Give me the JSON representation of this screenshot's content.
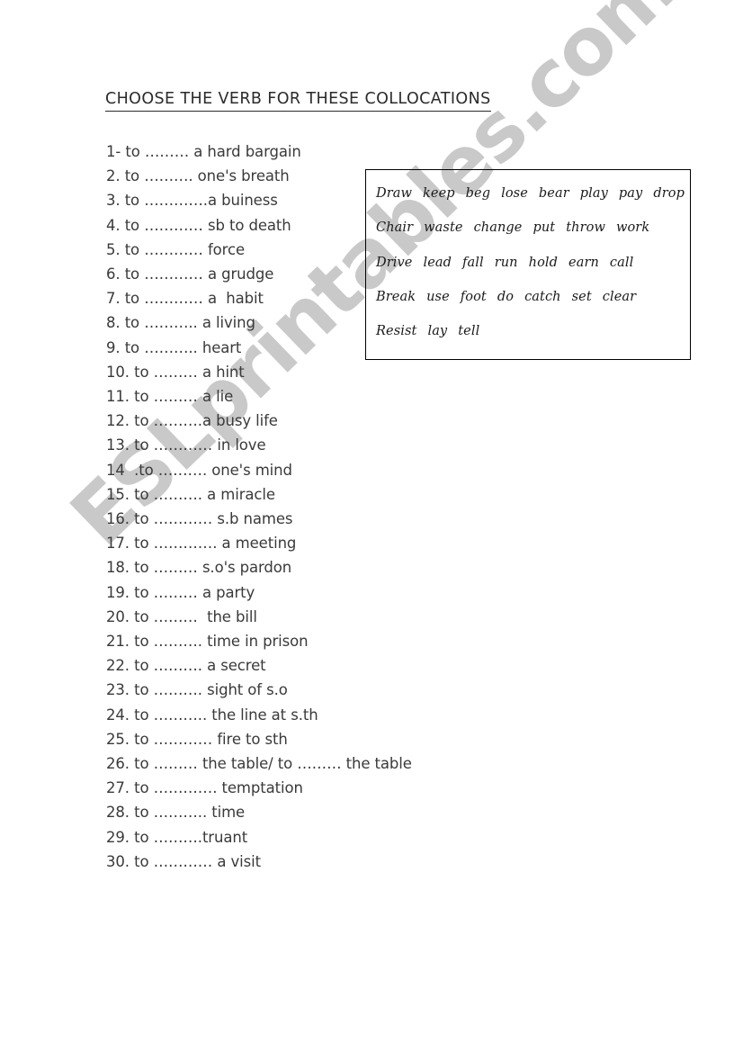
{
  "page": {
    "title": "CHOOSE THE VERB FOR THESE COLLOCATIONS",
    "watermark": "ESLprintables.com",
    "watermark_color": "#c9c9c9",
    "background_color": "#ffffff",
    "text_color": "#3a3a3a"
  },
  "exercise": {
    "items": [
      "1- to ……… a hard bargain",
      "2. to ………. one's breath",
      "3. to ………….a buiness",
      "4. to ………… sb to death",
      "5. to ………… force",
      "6. to ………… a grudge",
      "7. to ………… a  habit",
      "8. to ……….. a living",
      "9. to ……….. heart",
      "10. to ……… a hint",
      "11. to ……… a lie",
      "12. to ……….a busy life",
      "13. to ………… in love",
      "14  .to ………. one's mind",
      "15. to ………. a miracle",
      "16. to ………… s.b names",
      "17. to …………. a meeting",
      "18. to ……… s.o's pardon",
      "19. to ……… a party",
      "20. to ………  the bill",
      "21. to ………. time in prison",
      "22. to ………. a secret",
      "23. to ………. sight of s.o",
      "24. to ……….. the line at s.th",
      "25. to ………… fire to sth",
      "26. to ……… the table/ to ……… the table",
      "27. to …………. temptation",
      "28. to ……….. time",
      "29. to ……….truant",
      "30. to ………… a visit"
    ]
  },
  "word_bank": {
    "rows": [
      [
        "Draw",
        "keep",
        "beg",
        "lose",
        "bear",
        "play",
        "pay",
        "drop"
      ],
      [
        "Chair",
        "waste",
        "change",
        "put",
        "throw",
        "work"
      ],
      [
        "Drive",
        "lead",
        "fall",
        "run",
        "hold",
        "earn",
        "call"
      ],
      [
        "Break",
        "use",
        "foot",
        "do",
        "catch",
        "set",
        "clear"
      ],
      [
        "Resist",
        "lay",
        "tell"
      ]
    ],
    "border_color": "#000000"
  }
}
